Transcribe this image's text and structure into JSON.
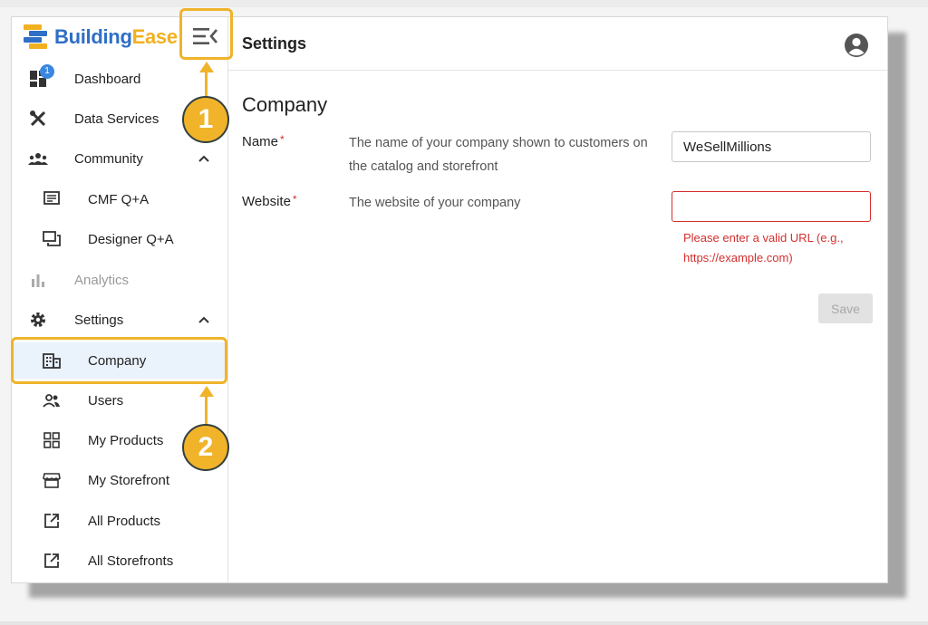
{
  "brand": {
    "part1": "Building",
    "part2": "Ease"
  },
  "badge_count": "1",
  "sidebar": {
    "items": [
      {
        "label": "Dashboard"
      },
      {
        "label": "Data Services"
      },
      {
        "label": "Community"
      },
      {
        "label": "CMF Q+A"
      },
      {
        "label": "Designer Q+A"
      },
      {
        "label": "Analytics"
      },
      {
        "label": "Settings"
      },
      {
        "label": "Company"
      },
      {
        "label": "Users"
      },
      {
        "label": "My Products"
      },
      {
        "label": "My Storefront"
      },
      {
        "label": "All Products"
      },
      {
        "label": "All Storefronts"
      }
    ]
  },
  "header": {
    "title": "Settings"
  },
  "section": {
    "title": "Company"
  },
  "fields": {
    "name": {
      "label": "Name",
      "required": "*",
      "description": "The name of your company shown to customers on the catalog and storefront",
      "value": "WeSellMillions"
    },
    "website": {
      "label": "Website",
      "required": "*",
      "description": "The website of your company",
      "value": "",
      "error": "Please enter a valid URL (e.g., https://example.com)"
    }
  },
  "save_label": "Save",
  "annotations": {
    "step1": "1",
    "step2": "2"
  },
  "colors": {
    "accent": "#f0b32a",
    "brand_blue": "#2f6fc6",
    "brand_yellow": "#f2b01e",
    "error": "#d32f2f",
    "badge": "#3a87e0"
  }
}
